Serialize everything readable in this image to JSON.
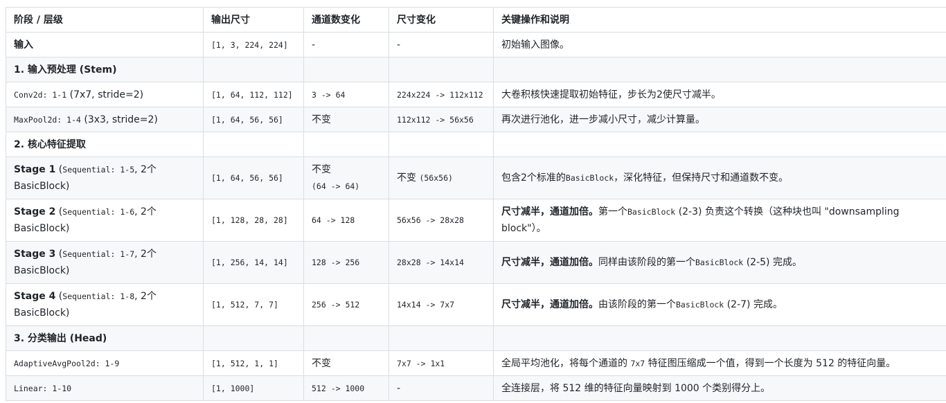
{
  "headers": [
    "阶段 / 层级",
    "输出尺寸",
    "通道数变化",
    "尺寸变化",
    "关键操作和说明"
  ],
  "rows": {
    "input": {
      "stage": "输入",
      "shape": "[1, 3, 224, 224]",
      "channels": "-",
      "size": "-",
      "desc": "初始输入图像。"
    },
    "sec1": {
      "title": "1. 输入预处理 (Stem)"
    },
    "conv": {
      "code": "Conv2d: 1-1",
      "extra": " (7x7, stride=2)",
      "shape": "[1, 64, 112, 112]",
      "channels": "3 -> 64",
      "size": "224x224 -> 112x112",
      "desc": "大卷积核快速提取初始特征，步长为2使尺寸减半。"
    },
    "pool": {
      "code": "MaxPool2d: 1-4",
      "extra": " (3x3, stride=2)",
      "shape": "[1, 64, 56, 56]",
      "channels": "不变",
      "size": "112x112 -> 56x56",
      "desc": "再次进行池化，进一步减小尺寸，减少计算量。"
    },
    "sec2": {
      "title": "2. 核心特征提取"
    },
    "s1": {
      "name": "Stage 1",
      "code": "Sequential: 1-5",
      "after": ", 2个 BasicBlock)",
      "shape": "[1, 64, 56, 56]",
      "channels": "不变",
      "channels_sub": "(64 -> 64)",
      "size": "不变",
      "size_code": "(56x56)",
      "desc_a": "包含2个标准的",
      "desc_code": "BasicBlock",
      "desc_b": "，深化特征，但保持尺寸和通道数不变。"
    },
    "s2": {
      "name": "Stage 2",
      "code": "Sequential: 1-6",
      "after": ", 2个 BasicBlock)",
      "shape": "[1, 128, 28, 28]",
      "channels": "64 -> 128",
      "size": "56x56 -> 28x28",
      "desc_bold": "尺寸减半，通道加倍。",
      "desc_a": "第一个",
      "desc_code": "BasicBlock",
      "desc_b": " (2-3) 负责这个转换（这种块也叫 \"downsampling block\"）。"
    },
    "s3": {
      "name": "Stage 3",
      "code": "Sequential: 1-7",
      "after": ", 2个 BasicBlock)",
      "shape": "[1, 256, 14, 14]",
      "channels": "128 -> 256",
      "size": "28x28 -> 14x14",
      "desc_bold": "尺寸减半，通道加倍。",
      "desc_a": "同样由该阶段的第一个",
      "desc_code": "BasicBlock",
      "desc_b": " (2-5) 完成。"
    },
    "s4": {
      "name": "Stage 4",
      "code": "Sequential: 1-8",
      "after": ", 2个 BasicBlock)",
      "shape": "[1, 512, 7, 7]",
      "channels": "256 -> 512",
      "size": "14x14 -> 7x7",
      "desc_bold": "尺寸减半，通道加倍。",
      "desc_a": "由该阶段的第一个",
      "desc_code": "BasicBlock",
      "desc_b": " (2-7) 完成。"
    },
    "sec3": {
      "title": "3. 分类输出 (Head)"
    },
    "avg": {
      "code": "AdaptiveAvgPool2d: 1-9",
      "shape": "[1, 512, 1, 1]",
      "channels": "不变",
      "size": "7x7 -> 1x1",
      "desc_a": "全局平均池化，将每个通道的 ",
      "desc_code": "7x7",
      "desc_b": " 特征图压缩成一个值，得到一个长度为 512 的特征向量。"
    },
    "lin": {
      "code": "Linear: 1-10",
      "shape": "[1, 1000]",
      "channels": "512 -> 1000",
      "size": "-",
      "desc": "全连接层，将 512 维的特征向量映射到 1000 个类别得分上。"
    }
  }
}
